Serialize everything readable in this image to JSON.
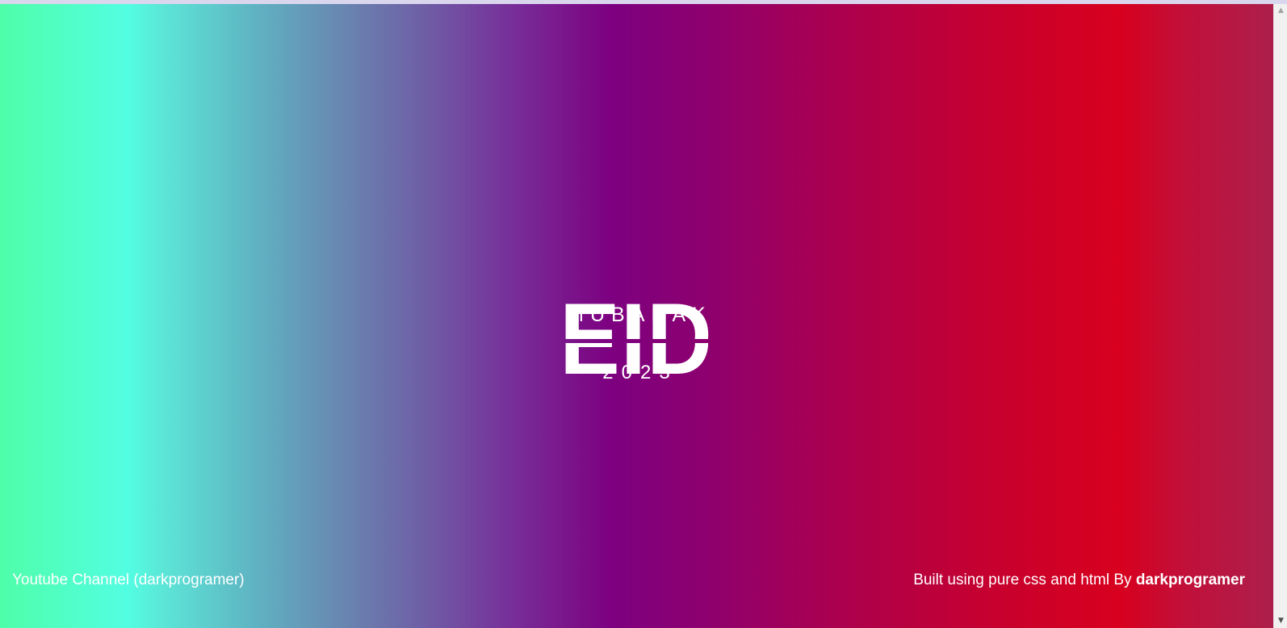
{
  "card": {
    "eid_word": "EID",
    "mubarak": "MUBARAK",
    "year": "2023"
  },
  "footer": {
    "left_text": "Youtube Channel (darkprogramer)",
    "right_prefix": "Built using pure css and html By",
    "right_author": "darkprogramer"
  },
  "colors": {
    "text": "#ffffff",
    "gradient_stops": [
      "#4ffea9",
      "#52fee1",
      "#6e60a6",
      "#7d0080",
      "#a1005a",
      "#d8001e",
      "#ad1f4b"
    ]
  },
  "scrollbar": {
    "up_icon": "▲",
    "down_icon": "▼"
  }
}
